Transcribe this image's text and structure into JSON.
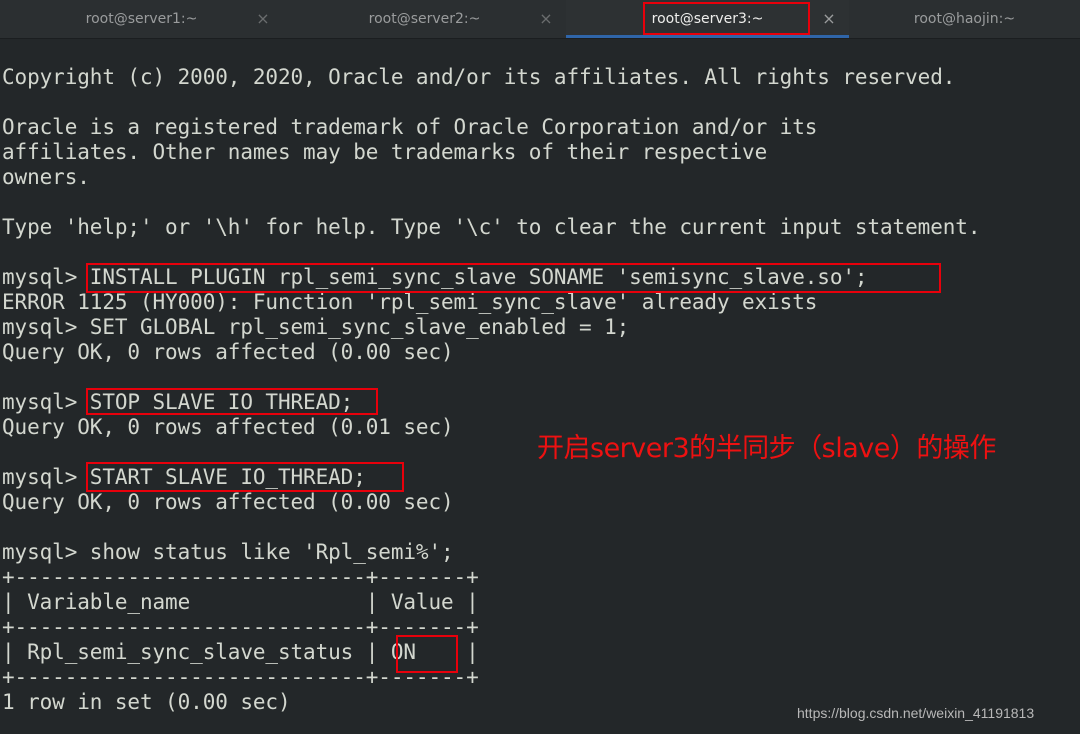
{
  "tabs": [
    {
      "label": "root@server1:~",
      "active": false
    },
    {
      "label": "root@server2:~",
      "active": false
    },
    {
      "label": "root@server3:~",
      "active": true
    },
    {
      "label": "root@haojin:~",
      "active": false
    }
  ],
  "close_glyph": "×",
  "terminal": {
    "lines": [
      "Copyright (c) 2000, 2020, Oracle and/or its affiliates. All rights reserved.",
      "",
      "Oracle is a registered trademark of Oracle Corporation and/or its",
      "affiliates. Other names may be trademarks of their respective",
      "owners.",
      "",
      "Type 'help;' or '\\h' for help. Type '\\c' to clear the current input statement.",
      "",
      "mysql> INSTALL PLUGIN rpl_semi_sync_slave SONAME 'semisync_slave.so';",
      "ERROR 1125 (HY000): Function 'rpl_semi_sync_slave' already exists",
      "mysql> SET GLOBAL rpl_semi_sync_slave_enabled = 1;",
      "Query OK, 0 rows affected (0.00 sec)",
      "",
      "mysql> STOP SLAVE IO_THREAD;",
      "Query OK, 0 rows affected (0.01 sec)",
      "",
      "mysql> START SLAVE IO_THREAD;",
      "Query OK, 0 rows affected (0.00 sec)",
      "",
      "mysql> show status like 'Rpl_semi%';",
      "+----------------------------+-------+",
      "| Variable_name              | Value |",
      "+----------------------------+-------+",
      "| Rpl_semi_sync_slave_status | ON    |",
      "+----------------------------+-------+",
      "1 row in set (0.00 sec)"
    ]
  },
  "status_table": {
    "columns": [
      "Variable_name",
      "Value"
    ],
    "rows": [
      [
        "Rpl_semi_sync_slave_status",
        "ON"
      ]
    ]
  },
  "annotation": "开启server3的半同步（slave）的操作",
  "watermark": "https://blog.csdn.net/weixin_41191813",
  "colors": {
    "highlight": "#e8000b",
    "annotation": "#ee1111",
    "background": "#232729",
    "active_tab_indicator": "#2f65a9"
  }
}
